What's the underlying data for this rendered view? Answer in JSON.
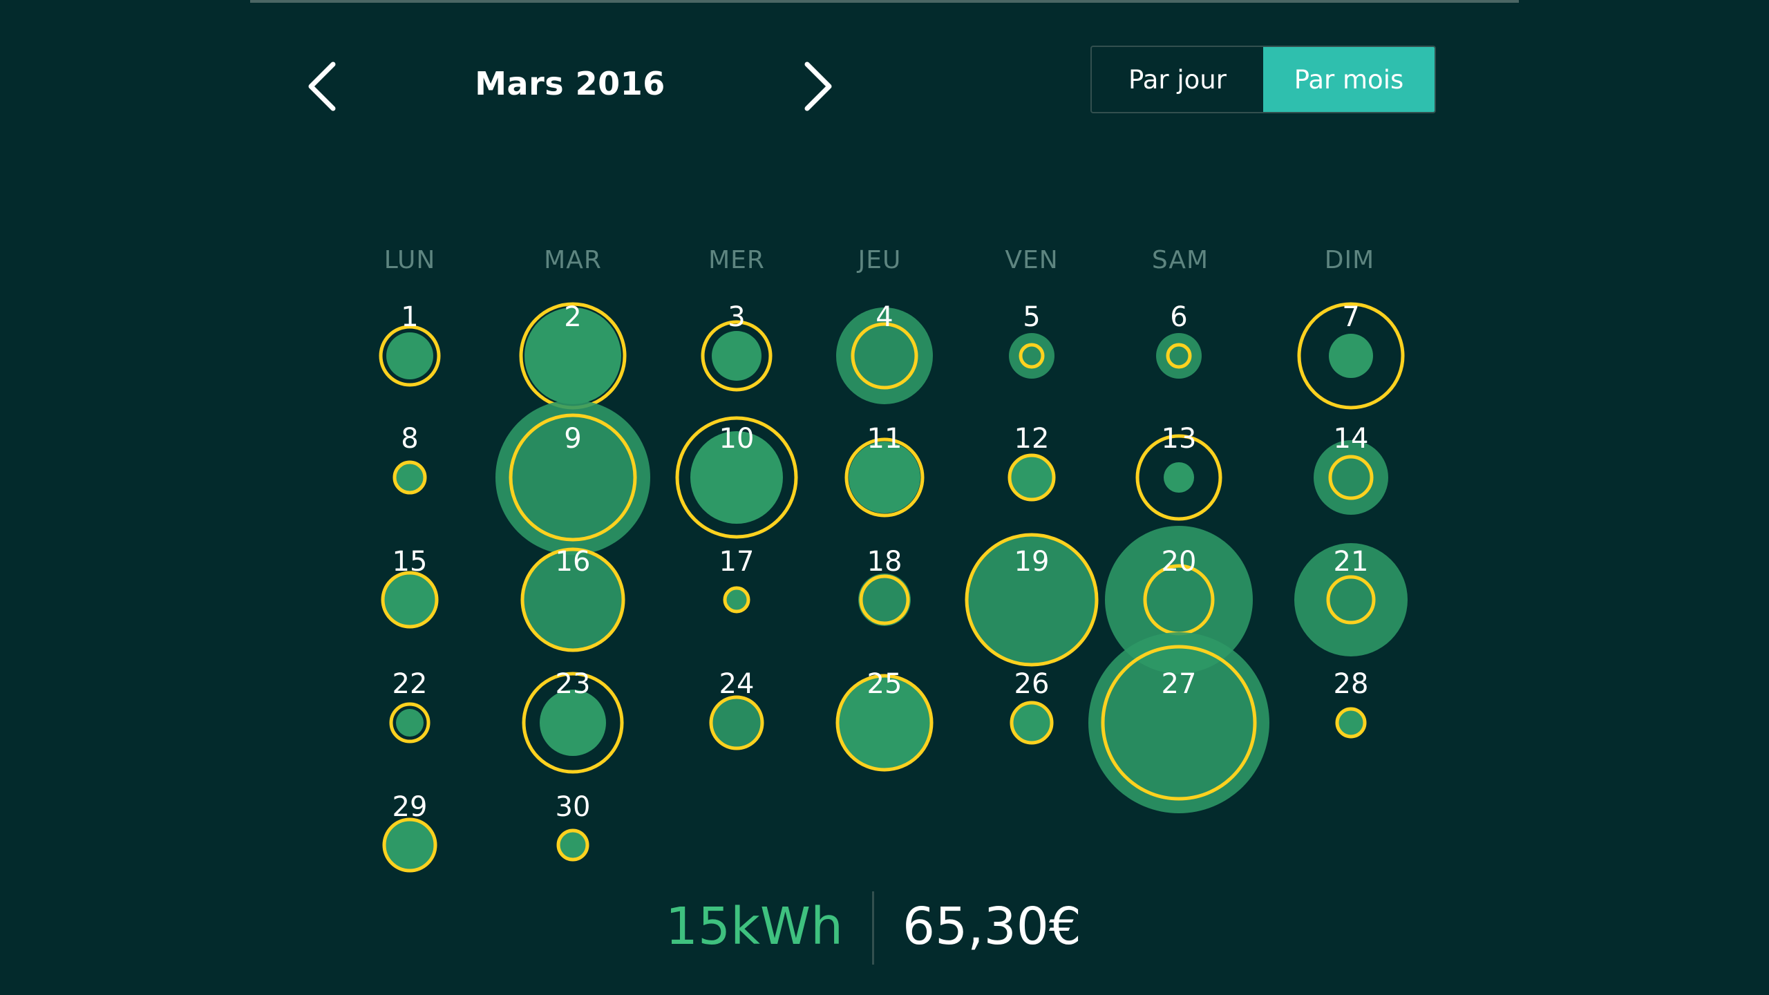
{
  "header": {
    "month_title": "Mars 2016",
    "prev_icon": "chevron-left-icon",
    "next_icon": "chevron-right-icon"
  },
  "view_toggle": {
    "options": [
      "Par jour",
      "Par mois"
    ],
    "selected": "Par mois"
  },
  "colors": {
    "background": "#032a2c",
    "bubble_fill": "#2e9966",
    "ring": "#ffd21f",
    "accent": "#2fbfae",
    "energy_text": "#3fc17f"
  },
  "calendar": {
    "weekdays": [
      "LUN",
      "MAR",
      "MER",
      "JEU",
      "VEN",
      "SAM",
      "DIM"
    ],
    "days": [
      {
        "day": "1"
      },
      {
        "day": "2"
      },
      {
        "day": "3"
      },
      {
        "day": "4"
      },
      {
        "day": "5"
      },
      {
        "day": "6"
      },
      {
        "day": "7"
      },
      {
        "day": "8"
      },
      {
        "day": "9"
      },
      {
        "day": "10"
      },
      {
        "day": "11"
      },
      {
        "day": "12"
      },
      {
        "day": "13"
      },
      {
        "day": "14"
      },
      {
        "day": "15"
      },
      {
        "day": "16"
      },
      {
        "day": "17"
      },
      {
        "day": "18"
      },
      {
        "day": "19"
      },
      {
        "day": "20"
      },
      {
        "day": "21"
      },
      {
        "day": "22"
      },
      {
        "day": "23"
      },
      {
        "day": "24"
      },
      {
        "day": "25"
      },
      {
        "day": "26"
      },
      {
        "day": "27"
      },
      {
        "day": "28"
      },
      {
        "day": "29"
      },
      {
        "day": "30"
      }
    ]
  },
  "summary": {
    "energy": "15kWh",
    "cost": "65,30€"
  }
}
